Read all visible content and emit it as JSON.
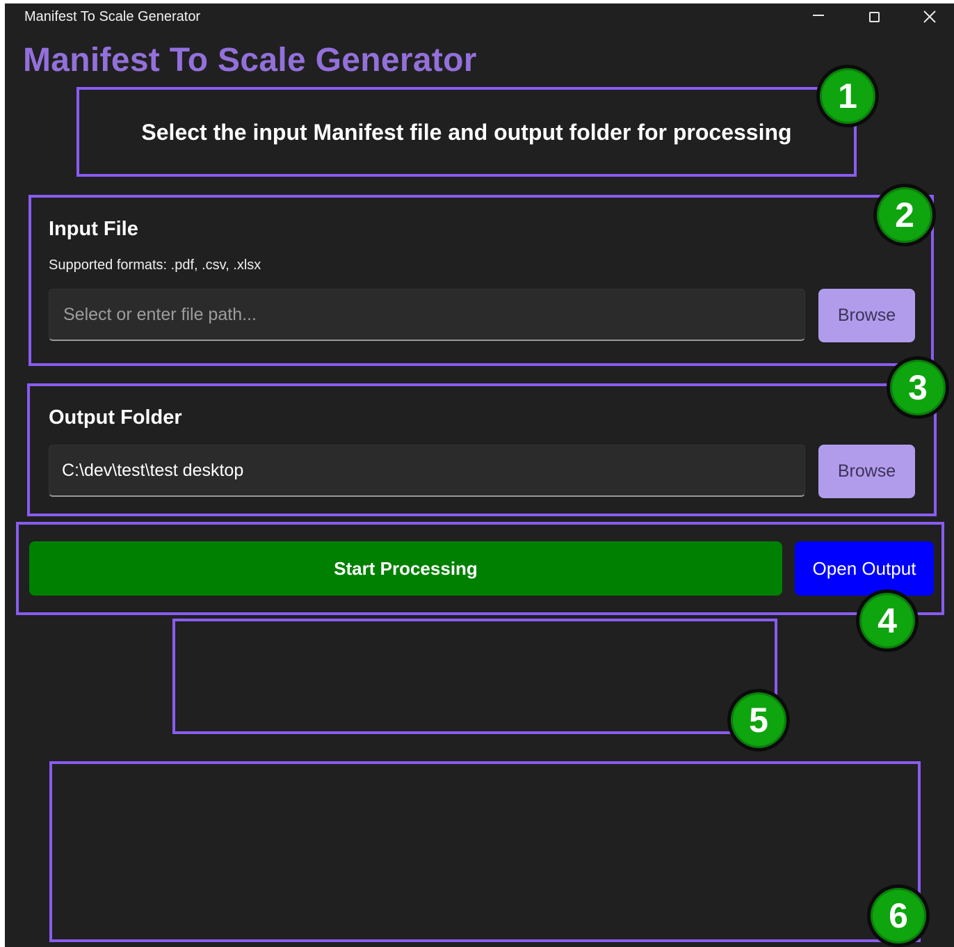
{
  "window": {
    "title": "Manifest To Scale Generator",
    "controls": {
      "minimize": "minimize-icon",
      "maximize": "maximize-icon",
      "close": "close-icon"
    }
  },
  "app": {
    "title": "Manifest To Scale Generator",
    "instruction": "Select the input Manifest file and output folder for processing"
  },
  "input_section": {
    "title": "Input File",
    "formats_hint": "Supported formats: .pdf, .csv, .xlsx",
    "path_value": "",
    "path_placeholder": "Select or enter file path...",
    "browse_label": "Browse"
  },
  "output_section": {
    "title": "Output Folder",
    "path_value": "C:\\dev\\test\\test desktop",
    "browse_label": "Browse"
  },
  "actions": {
    "start_label": "Start Processing",
    "open_label": "Open Output"
  },
  "annotations": [
    "1",
    "2",
    "3",
    "4",
    "5",
    "6"
  ],
  "colors": {
    "title_accent": "#9370db",
    "annotation_border": "#8a5cf0",
    "badge": "#0ea50e",
    "start_button": "#008000",
    "open_button": "#0000ff",
    "browse_button": "#b19cec",
    "background": "#202020"
  }
}
